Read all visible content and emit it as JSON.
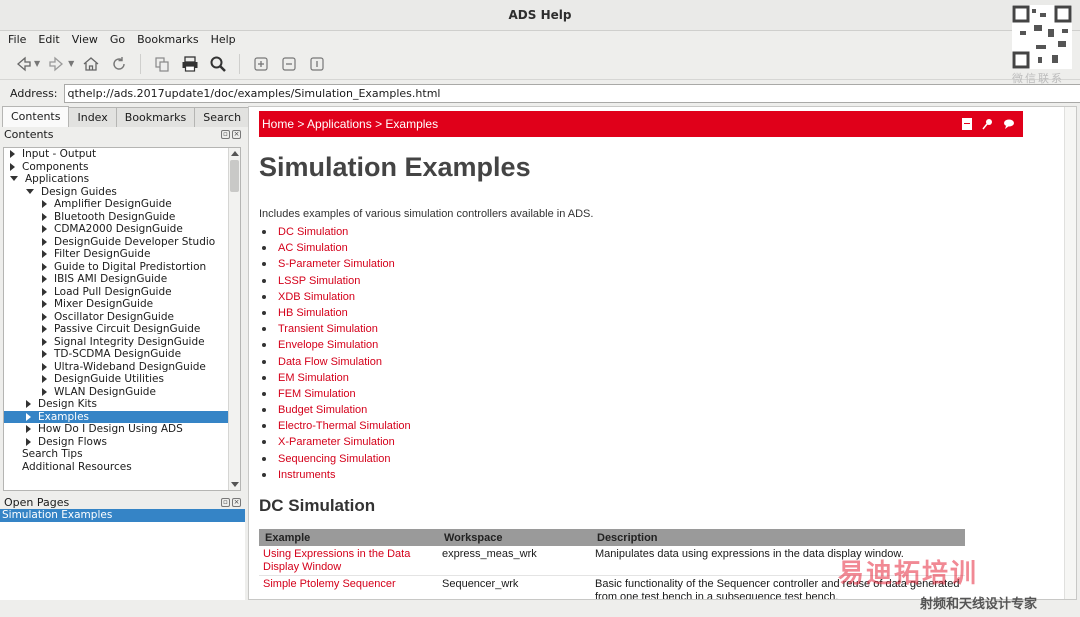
{
  "window": {
    "title": "ADS Help"
  },
  "menu": [
    "File",
    "Edit",
    "View",
    "Go",
    "Bookmarks",
    "Help"
  ],
  "address": {
    "label": "Address:",
    "value": "qthelp://ads.2017update1/doc/examples/Simulation_Examples.html"
  },
  "tabs": [
    "Contents",
    "Index",
    "Bookmarks",
    "Search"
  ],
  "contents": {
    "title": "Contents",
    "items": [
      {
        "label": "Input - Output",
        "level": 0,
        "state": "closed"
      },
      {
        "label": "Components",
        "level": 0,
        "state": "closed"
      },
      {
        "label": "Applications",
        "level": 0,
        "state": "open"
      },
      {
        "label": "Design Guides",
        "level": 1,
        "state": "open"
      },
      {
        "label": "Amplifier DesignGuide",
        "level": 2,
        "state": "closed"
      },
      {
        "label": "Bluetooth DesignGuide",
        "level": 2,
        "state": "closed"
      },
      {
        "label": "CDMA2000 DesignGuide",
        "level": 2,
        "state": "closed"
      },
      {
        "label": "DesignGuide Developer Studio",
        "level": 2,
        "state": "closed"
      },
      {
        "label": "Filter DesignGuide",
        "level": 2,
        "state": "closed"
      },
      {
        "label": "Guide to Digital Predistortion",
        "level": 2,
        "state": "closed"
      },
      {
        "label": "IBIS AMI DesignGuide",
        "level": 2,
        "state": "closed"
      },
      {
        "label": "Load Pull DesignGuide",
        "level": 2,
        "state": "closed"
      },
      {
        "label": "Mixer DesignGuide",
        "level": 2,
        "state": "closed"
      },
      {
        "label": "Oscillator DesignGuide",
        "level": 2,
        "state": "closed"
      },
      {
        "label": "Passive Circuit DesignGuide",
        "level": 2,
        "state": "closed"
      },
      {
        "label": "Signal Integrity DesignGuide",
        "level": 2,
        "state": "closed"
      },
      {
        "label": "TD-SCDMA DesignGuide",
        "level": 2,
        "state": "closed"
      },
      {
        "label": "Ultra-Wideband DesignGuide",
        "level": 2,
        "state": "closed"
      },
      {
        "label": "DesignGuide Utilities",
        "level": 2,
        "state": "closed"
      },
      {
        "label": "WLAN DesignGuide",
        "level": 2,
        "state": "closed"
      },
      {
        "label": "Design Kits",
        "level": 1,
        "state": "closed"
      },
      {
        "label": "Examples",
        "level": 1,
        "state": "closed",
        "selected": true
      },
      {
        "label": "How Do I Design Using ADS",
        "level": 1,
        "state": "closed"
      },
      {
        "label": "Design Flows",
        "level": 1,
        "state": "closed"
      },
      {
        "label": "Search Tips",
        "level": 0,
        "state": "none"
      },
      {
        "label": "Additional Resources",
        "level": 0,
        "state": "none"
      }
    ]
  },
  "open_pages": {
    "title": "Open Pages",
    "items": [
      "Simulation Examples"
    ]
  },
  "page": {
    "breadcrumb": "Home > Applications > Examples",
    "title": "Simulation Examples",
    "intro": "Includes examples of various simulation controllers available in ADS.",
    "links": [
      "DC Simulation",
      "AC Simulation",
      "S-Parameter Simulation",
      "LSSP Simulation",
      "XDB Simulation",
      "HB Simulation",
      "Transient Simulation",
      "Envelope Simulation",
      "Data Flow Simulation",
      "EM Simulation",
      "FEM Simulation",
      "Budget Simulation",
      "Electro-Thermal Simulation",
      "X-Parameter Simulation",
      "Sequencing Simulation",
      "Instruments"
    ],
    "section_title": "DC Simulation",
    "table": {
      "headers": [
        "Example",
        "Workspace",
        "Description"
      ],
      "rows": [
        [
          "Using Expressions in the Data Display Window",
          "express_meas_wrk",
          "Manipulates data using expressions in the data display window."
        ],
        [
          "Simple Ptolemy Sequencer",
          "Sequencer_wrk",
          "Basic functionality of the Sequencer controller and reuse of data generated from one test bench in a subsequence test bench."
        ]
      ]
    }
  },
  "watermark": {
    "qr_caption": "微信联系",
    "brand": "易迪拓培训",
    "slogan": "射频和天线设计专家"
  },
  "colors": {
    "accent": "#e0001a",
    "link": "#d4001a",
    "selection": "#3584c6"
  }
}
